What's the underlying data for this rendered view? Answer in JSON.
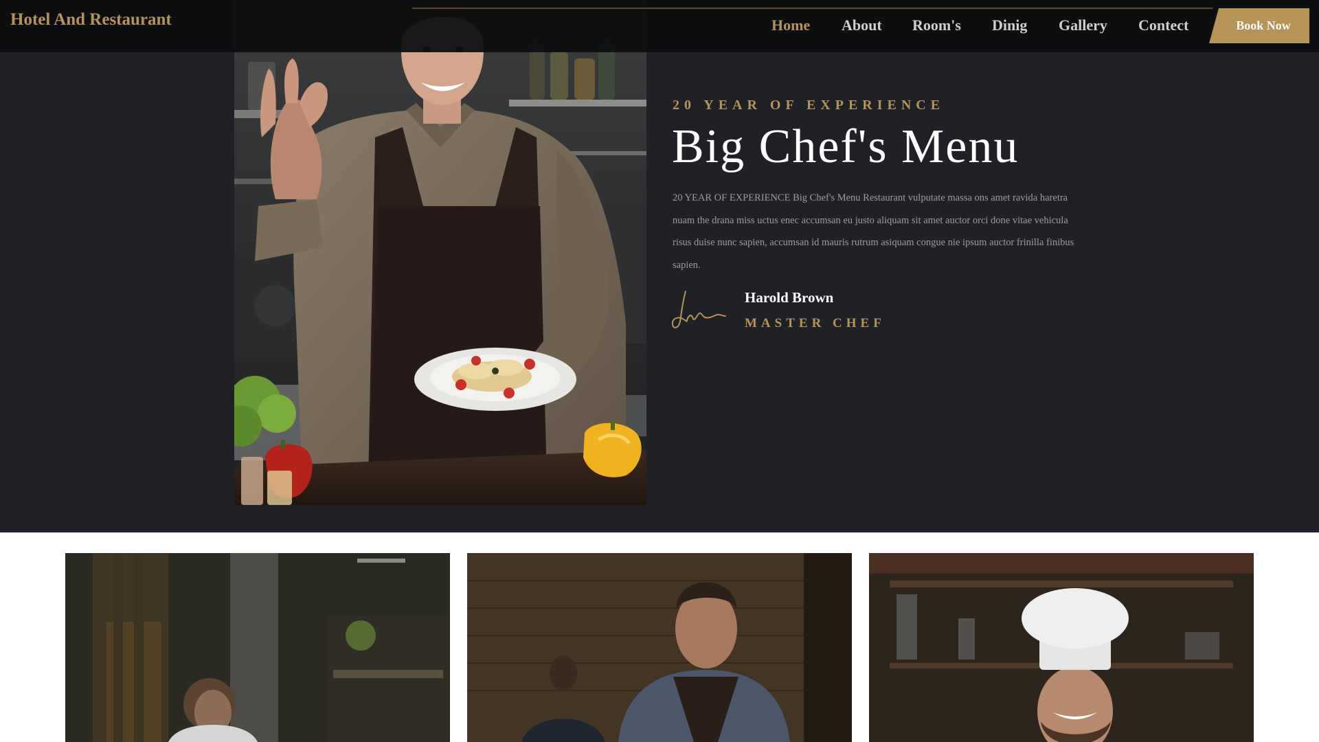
{
  "navbar": {
    "brand": "Hotel And Restaurant",
    "links": [
      "Home",
      "About",
      "Room's",
      "Dinig",
      "Gallery",
      "Contect"
    ],
    "active": "Home",
    "cta": "Book Now"
  },
  "about": {
    "eyebrow": "20 YEAR OF EXPERIENCE",
    "title": "Big Chef's Menu",
    "description": "20 YEAR OF EXPERIENCE Big Chef's Menu Restaurant vulputate massa ons amet ravida haretra nuam the drana miss uctus enec accumsan eu justo aliquam sit amet auctor orci done vitae vehicula risus duise nunc sapien, accumsan id mauris rutrum asiquam congue nie ipsum auctor frinilla finibus sapien.",
    "chef_name": "Harold Brown",
    "chef_role": "MASTER CHEF"
  },
  "colors": {
    "accent": "#b69458",
    "hero_bg": "#1f2126",
    "nav_bg": "#0c0d0f",
    "text_muted": "#9a9ca1"
  }
}
